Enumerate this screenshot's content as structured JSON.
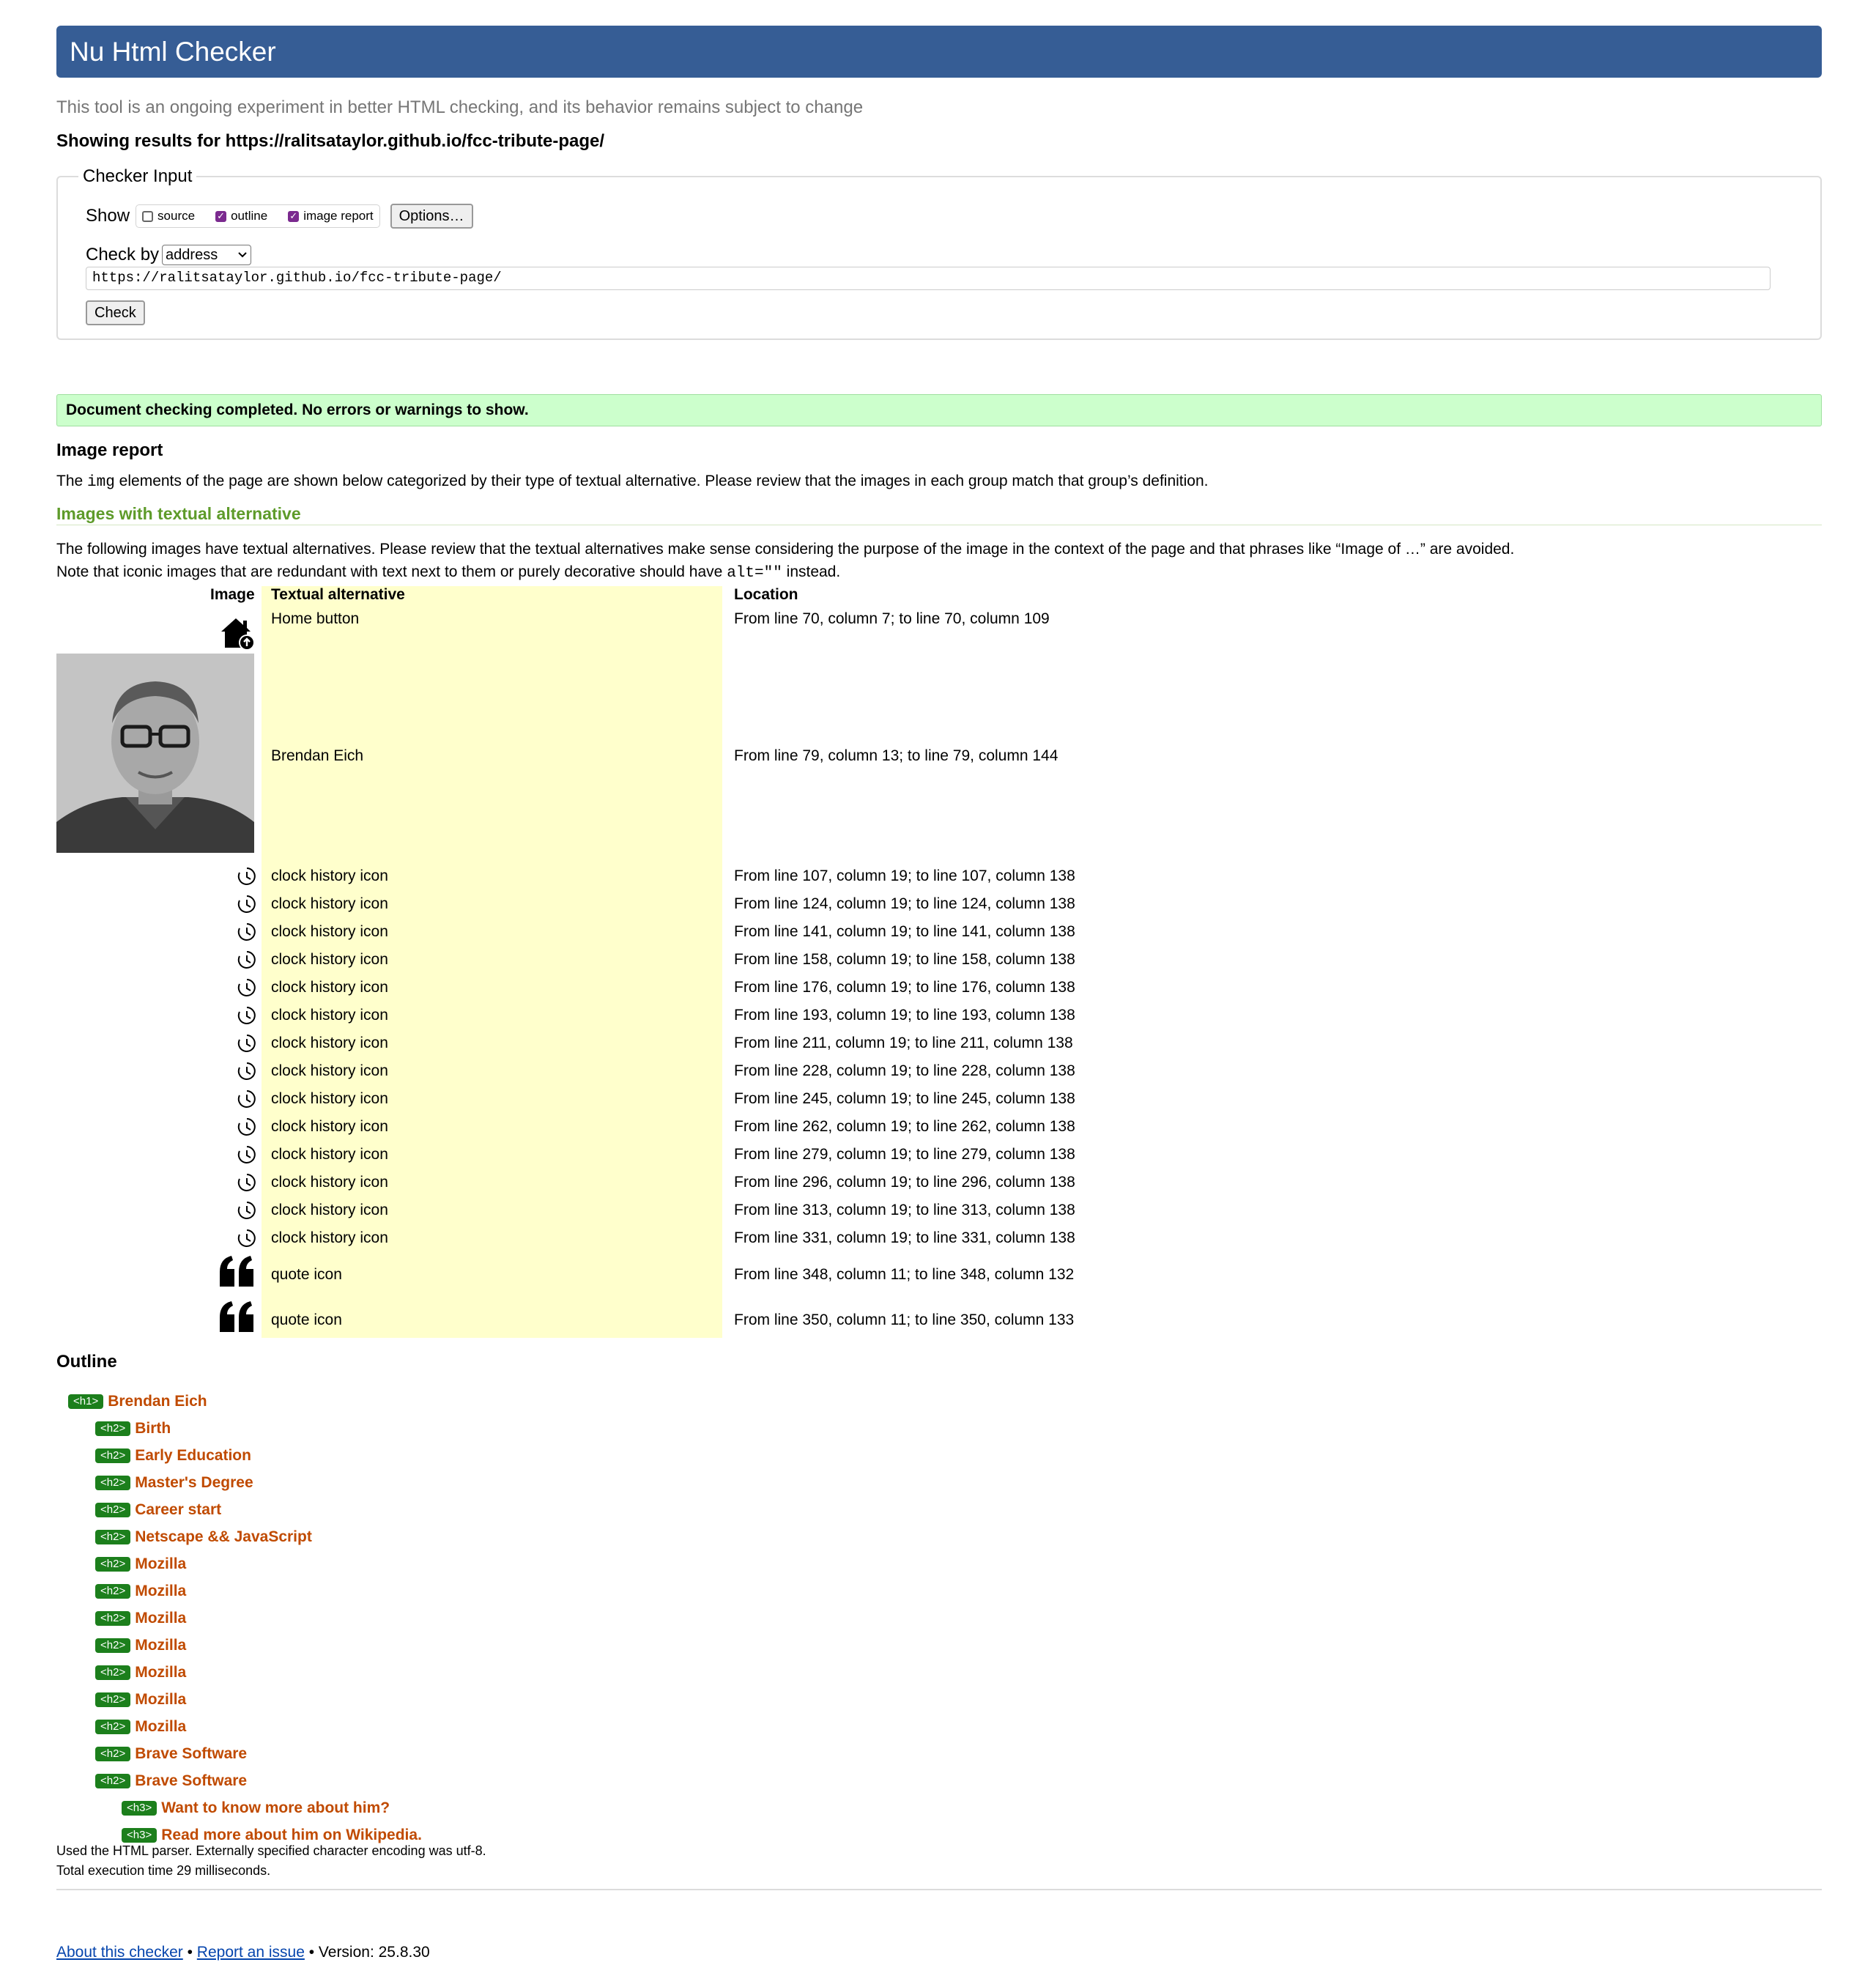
{
  "header": {
    "title": "Nu Html Checker"
  },
  "subtitle": "This tool is an ongoing experiment in better HTML checking, and its behavior remains subject to change",
  "showing_results": "Showing results for https://ralitsataylor.github.io/fcc-tribute-page/",
  "checker_input": {
    "legend": "Checker Input",
    "show_label": "Show",
    "options": [
      {
        "label": "source",
        "checked": false
      },
      {
        "label": "outline",
        "checked": true
      },
      {
        "label": "image report",
        "checked": true
      }
    ],
    "options_button": "Options…",
    "check_by_label": "Check by",
    "check_by_value": "address",
    "url_value": "https://ralitsataylor.github.io/fcc-tribute-page/",
    "check_button": "Check"
  },
  "status_message": "Document checking completed. No errors or warnings to show.",
  "image_report": {
    "heading": "Image report",
    "desc_before": "The ",
    "desc_code": "img",
    "desc_after": " elements of the page are shown below categorized by their type of textual alternative. Please review that the images in each group match that group’s definition.",
    "section_heading": "Images with textual alternative",
    "note_line1": "The following images have textual alternatives. Please review that the textual alternatives make sense considering the purpose of the image in the context of the page and that phrases like “Image of …” are avoided.",
    "note_line2_before": "Note that iconic images that are redundant with text next to them or purely decorative should have ",
    "note_line2_code": "alt=\"\"",
    "note_line2_after": " instead.",
    "columns": [
      "Image",
      "Textual alternative",
      "Location"
    ],
    "rows": [
      {
        "icon": "home-upload-icon",
        "alt": "Home button",
        "location": "From line 70, column 7; to line 70, column 109"
      },
      {
        "icon": "portrait-photo",
        "alt": "Brendan Eich",
        "location": "From line 79, column 13; to line 79, column 144"
      },
      {
        "icon": "clock-history-icon",
        "alt": "clock history icon",
        "location": "From line 107, column 19; to line 107, column 138"
      },
      {
        "icon": "clock-history-icon",
        "alt": "clock history icon",
        "location": "From line 124, column 19; to line 124, column 138"
      },
      {
        "icon": "clock-history-icon",
        "alt": "clock history icon",
        "location": "From line 141, column 19; to line 141, column 138"
      },
      {
        "icon": "clock-history-icon",
        "alt": "clock history icon",
        "location": "From line 158, column 19; to line 158, column 138"
      },
      {
        "icon": "clock-history-icon",
        "alt": "clock history icon",
        "location": "From line 176, column 19; to line 176, column 138"
      },
      {
        "icon": "clock-history-icon",
        "alt": "clock history icon",
        "location": "From line 193, column 19; to line 193, column 138"
      },
      {
        "icon": "clock-history-icon",
        "alt": "clock history icon",
        "location": "From line 211, column 19; to line 211, column 138"
      },
      {
        "icon": "clock-history-icon",
        "alt": "clock history icon",
        "location": "From line 228, column 19; to line 228, column 138"
      },
      {
        "icon": "clock-history-icon",
        "alt": "clock history icon",
        "location": "From line 245, column 19; to line 245, column 138"
      },
      {
        "icon": "clock-history-icon",
        "alt": "clock history icon",
        "location": "From line 262, column 19; to line 262, column 138"
      },
      {
        "icon": "clock-history-icon",
        "alt": "clock history icon",
        "location": "From line 279, column 19; to line 279, column 138"
      },
      {
        "icon": "clock-history-icon",
        "alt": "clock history icon",
        "location": "From line 296, column 19; to line 296, column 138"
      },
      {
        "icon": "clock-history-icon",
        "alt": "clock history icon",
        "location": "From line 313, column 19; to line 313, column 138"
      },
      {
        "icon": "clock-history-icon",
        "alt": "clock history icon",
        "location": "From line 331, column 19; to line 331, column 138"
      },
      {
        "icon": "quote-icon",
        "alt": "quote icon",
        "location": "From line 348, column 11; to line 348, column 132"
      },
      {
        "icon": "quote-icon",
        "alt": "quote icon",
        "location": "From line 350, column 11; to line 350, column 133"
      }
    ]
  },
  "outline": {
    "heading": "Outline",
    "items": [
      {
        "tag": "<h1>",
        "text": "Brendan Eich",
        "level": 1
      },
      {
        "tag": "<h2>",
        "text": "Birth",
        "level": 2
      },
      {
        "tag": "<h2>",
        "text": "Early Education",
        "level": 2
      },
      {
        "tag": "<h2>",
        "text": "Master's Degree",
        "level": 2
      },
      {
        "tag": "<h2>",
        "text": "Career start",
        "level": 2
      },
      {
        "tag": "<h2>",
        "text": "Netscape && JavaScript",
        "level": 2
      },
      {
        "tag": "<h2>",
        "text": "Mozilla",
        "level": 2
      },
      {
        "tag": "<h2>",
        "text": "Mozilla",
        "level": 2
      },
      {
        "tag": "<h2>",
        "text": "Mozilla",
        "level": 2
      },
      {
        "tag": "<h2>",
        "text": "Mozilla",
        "level": 2
      },
      {
        "tag": "<h2>",
        "text": "Mozilla",
        "level": 2
      },
      {
        "tag": "<h2>",
        "text": "Mozilla",
        "level": 2
      },
      {
        "tag": "<h2>",
        "text": "Mozilla",
        "level": 2
      },
      {
        "tag": "<h2>",
        "text": "Brave Software",
        "level": 2
      },
      {
        "tag": "<h2>",
        "text": "Brave Software",
        "level": 2
      },
      {
        "tag": "<h3>",
        "text": "Want to know more about him?",
        "level": 3
      },
      {
        "tag": "<h3>",
        "text": "Read more about him on Wikipedia.",
        "level": 3
      }
    ]
  },
  "footer": {
    "parser_note": "Used the HTML parser. Externally specified character encoding was utf-8.",
    "execution_time": "Total execution time 29 milliseconds.",
    "about_link": "About this checker",
    "separator": " • ",
    "report_link": "Report an issue",
    "version": " • Version: 25.8.30"
  },
  "colors": {
    "header_bg": "#365d95",
    "success_bg": "#ccffcc",
    "section_heading": "#5e9b2a",
    "alt_column_bg": "#ffffcc",
    "outline_tag_bg": "#1c7f1c",
    "outline_text": "#c04a00",
    "link": "#0645ad"
  }
}
